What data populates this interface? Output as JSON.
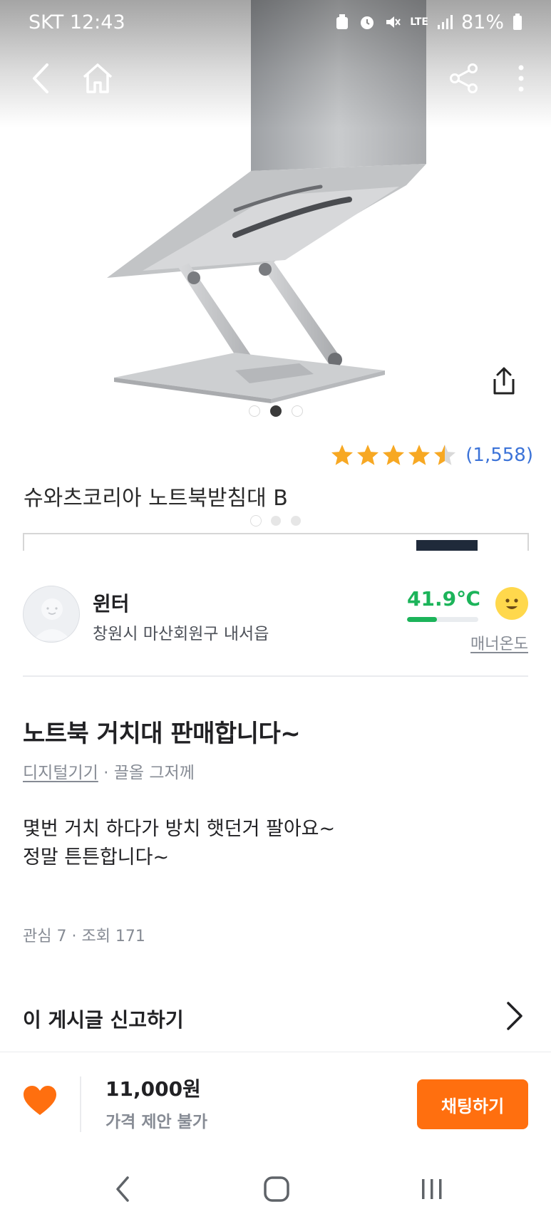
{
  "status_bar": {
    "carrier_time": "SKT 12:43",
    "network": "LTE",
    "battery": "81%",
    "icons": [
      "recycle-icon",
      "alarm-icon",
      "mute-icon",
      "lte-icon",
      "signal-icon",
      "battery-icon"
    ]
  },
  "top_nav": {
    "icons": [
      "back-arrow-icon",
      "home-icon",
      "share-icon",
      "more-vertical-icon"
    ]
  },
  "product_card": {
    "image_dots": {
      "count": 3,
      "active_index": 1
    },
    "rating_stars": 4.5,
    "rating_count": "(1,558)",
    "product_name": "슈와츠코리아 노트북받침대 B",
    "secondary_dots_active_index": 0
  },
  "seller": {
    "name": "윈터",
    "location": "창원시 마산회원구 내서읍",
    "manner_temp": "41.9℃",
    "manner_temp_fraction": 0.42,
    "manner_label": "매너온도",
    "colors": {
      "temp": "#1cb45a",
      "face": "#ffd84c"
    }
  },
  "post": {
    "title": "노트북 거치대 판매합니다~",
    "category": "디지털기기",
    "time_meta": "· 끌올 그저께",
    "body": "몇번 거치 하다가 방치 햇던거 팔아요~\n정말 튼튼합니다~",
    "stats": "관심 7 · 조회 171"
  },
  "report": {
    "label": "이 게시글 신고하기"
  },
  "bottom_bar": {
    "price": "11,000원",
    "negotiation": "가격 제안 불가",
    "chat_button": "채팅하기",
    "accent": "#ff6f0f"
  },
  "system_nav": {
    "icons": [
      "system-back-icon",
      "system-home-icon",
      "system-recents-icon"
    ]
  }
}
